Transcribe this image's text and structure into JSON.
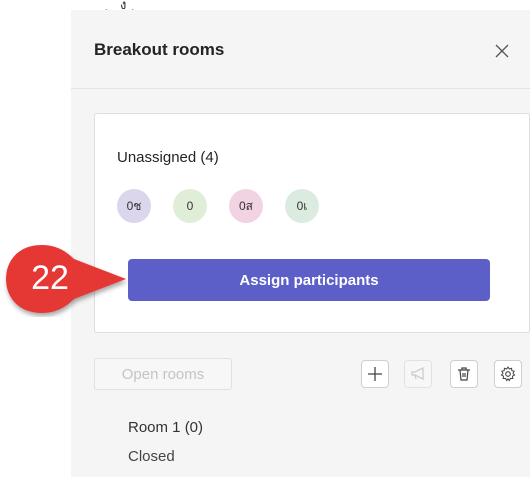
{
  "top_strip_text": "ู ุ ง ุ",
  "panel": {
    "title": "Breakout rooms",
    "close_icon": "close-icon"
  },
  "unassigned": {
    "title": "Unassigned (4)",
    "avatars": [
      {
        "initials": "0ช",
        "color": "#dcd6ec"
      },
      {
        "initials": "0",
        "color": "#e0eed8"
      },
      {
        "initials": "0ส",
        "color": "#f1d3e3"
      },
      {
        "initials": "0เ",
        "color": "#dcebe0"
      }
    ],
    "assign_label": "Assign participants"
  },
  "toolbar": {
    "open_rooms_label": "Open rooms",
    "icons": [
      "add-icon",
      "megaphone-icon",
      "trash-icon",
      "gear-icon"
    ]
  },
  "rooms": [
    {
      "name": "Room 1 (0)",
      "status": "Closed"
    }
  ],
  "callout": {
    "number": "22",
    "color": "#e53935"
  },
  "colors": {
    "accent": "#5b5fc7"
  }
}
